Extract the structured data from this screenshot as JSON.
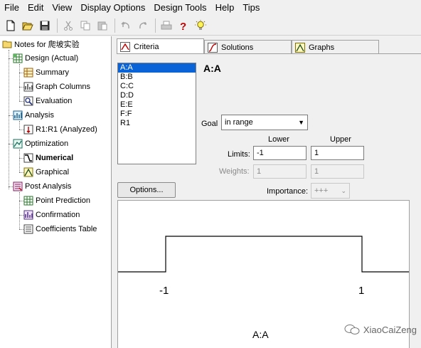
{
  "menu": [
    "File",
    "Edit",
    "View",
    "Display Options",
    "Design Tools",
    "Help",
    "Tips"
  ],
  "toolbar_icons": [
    "new-icon",
    "open-icon",
    "save-icon",
    "cut-icon",
    "copy-icon",
    "paste-icon",
    "undo-icon",
    "redo-icon",
    "print-icon",
    "help-icon",
    "tip-bulb-icon"
  ],
  "tree": {
    "root": "Notes for 爬坡实验",
    "design": "Design (Actual)",
    "summary": "Summary",
    "graph_columns": "Graph Columns",
    "evaluation": "Evaluation",
    "analysis": "Analysis",
    "r1": "R1:R1 (Analyzed)",
    "optimization": "Optimization",
    "numerical": "Numerical",
    "graphical": "Graphical",
    "post_analysis": "Post Analysis",
    "point_prediction": "Point Prediction",
    "confirmation": "Confirmation",
    "coefficients_table": "Coefficients Table"
  },
  "tabs": [
    "Criteria",
    "Solutions",
    "Graphs"
  ],
  "factors": [
    "A:A",
    "B:B",
    "C:C",
    "D:D",
    "E:E",
    "F:F",
    "R1"
  ],
  "selected_factor": "A:A",
  "form": {
    "goal_label": "Goal",
    "goal_value": "in range",
    "lower_label": "Lower",
    "upper_label": "Upper",
    "limits_label": "Limits:",
    "weights_label": "Weights:",
    "importance_label": "Importance:",
    "lower_limit": "-1",
    "upper_limit": "1",
    "lower_weight": "1",
    "upper_weight": "1",
    "importance": "+++",
    "options_button": "Options..."
  },
  "desirability_graph": {
    "lower_tick": "-1",
    "upper_tick": "1",
    "x_label": "A:A"
  },
  "watermark": "XiaoCaiZeng"
}
